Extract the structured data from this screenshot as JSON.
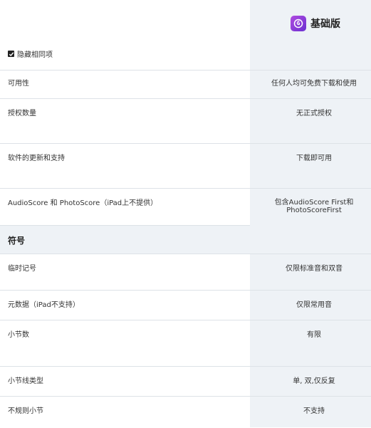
{
  "header": {
    "edition_name": "基础版",
    "edition_icon": "sibelius-logo-icon",
    "hide_same_label": "隐藏相同项",
    "hide_same_checked": true
  },
  "rows_general": [
    {
      "label": "可用性",
      "value": "任何人均可免费下载和使用"
    },
    {
      "label": "授权数量",
      "value": "无正式授权"
    },
    {
      "label": "软件的更新和支持",
      "value": "下载即可用"
    },
    {
      "label": "AudioScore 和 PhotoScore（iPad上不提供）",
      "value_line1": "包含AudioScore First和",
      "value_line2": "PhotoScoreFirst"
    }
  ],
  "section": {
    "title": "符号"
  },
  "rows_notation": [
    {
      "label": "临时记号",
      "value": "仅限标准音和双音"
    },
    {
      "label": "元数据（iPad不支持）",
      "value": "仅限常用音"
    },
    {
      "label": "小节数",
      "value": "有限"
    },
    {
      "label": "小节线类型",
      "value": "单, 双,仅反复"
    },
    {
      "label": "不规则小节",
      "value": "不支持"
    }
  ],
  "colors": {
    "accent_purple": "#8a3ee0",
    "column_bg": "#eef2f6",
    "divider": "#dde2e7"
  }
}
